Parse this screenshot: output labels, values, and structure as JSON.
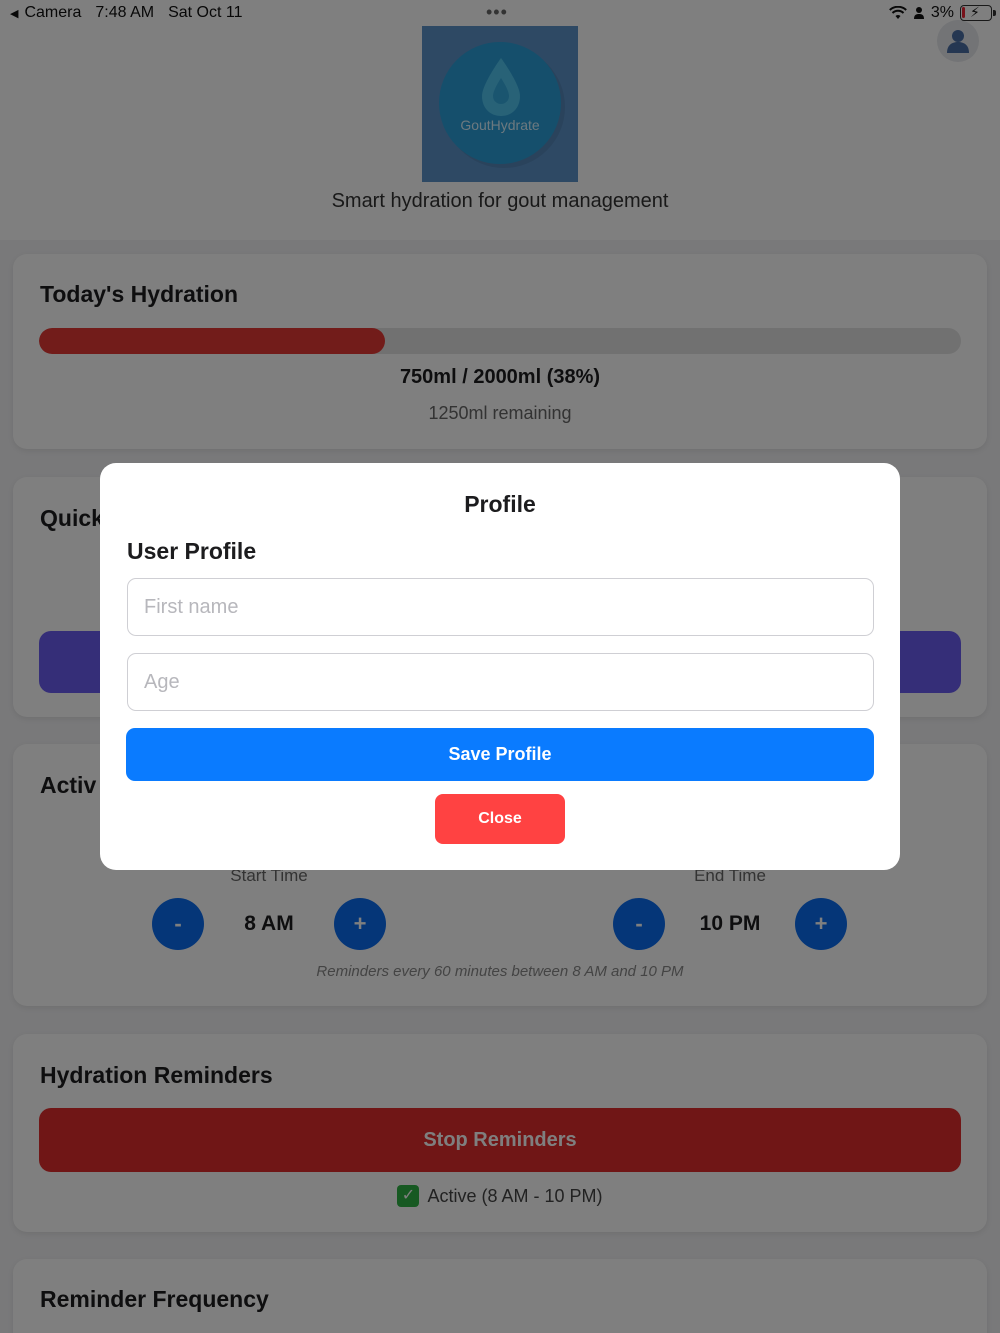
{
  "status_bar": {
    "back_app": "Camera",
    "time": "7:48 AM",
    "date": "Sat Oct 11",
    "dots": "•••",
    "battery_percent": "3%",
    "battery_fraction": 0.03
  },
  "header": {
    "logo_text": "GoutHydrate",
    "tagline": "Smart hydration for gout management"
  },
  "hydration": {
    "title": "Today's Hydration",
    "progress_fraction": 0.375,
    "progress_color": "#e53935",
    "amount_text": "750ml / 2000ml (38%)",
    "remaining_text": "1250ml remaining"
  },
  "quick_card": {
    "title_visible": "Quick",
    "button_color": "#6a5cf0"
  },
  "active_hours": {
    "title_visible": "Activ",
    "start_label": "Start Time",
    "start_value": "8 AM",
    "end_label": "End Time",
    "end_value": "10 PM",
    "minus_label": "-",
    "plus_label": "+",
    "note": "Reminders every 60 minutes between 8 AM and 10 PM"
  },
  "reminders": {
    "title": "Hydration Reminders",
    "stop_button_label": "Stop Reminders",
    "status_icon": "check-box-icon",
    "status_text": "Active (8 AM - 10 PM)"
  },
  "frequency": {
    "title": "Reminder Frequency"
  },
  "modal": {
    "title": "Profile",
    "subtitle": "User Profile",
    "first_name_placeholder": "First name",
    "first_name_value": "",
    "age_placeholder": "Age",
    "age_value": "",
    "save_label": "Save Profile",
    "close_label": "Close",
    "save_color": "#0a7bff",
    "close_color": "#ff4242"
  }
}
